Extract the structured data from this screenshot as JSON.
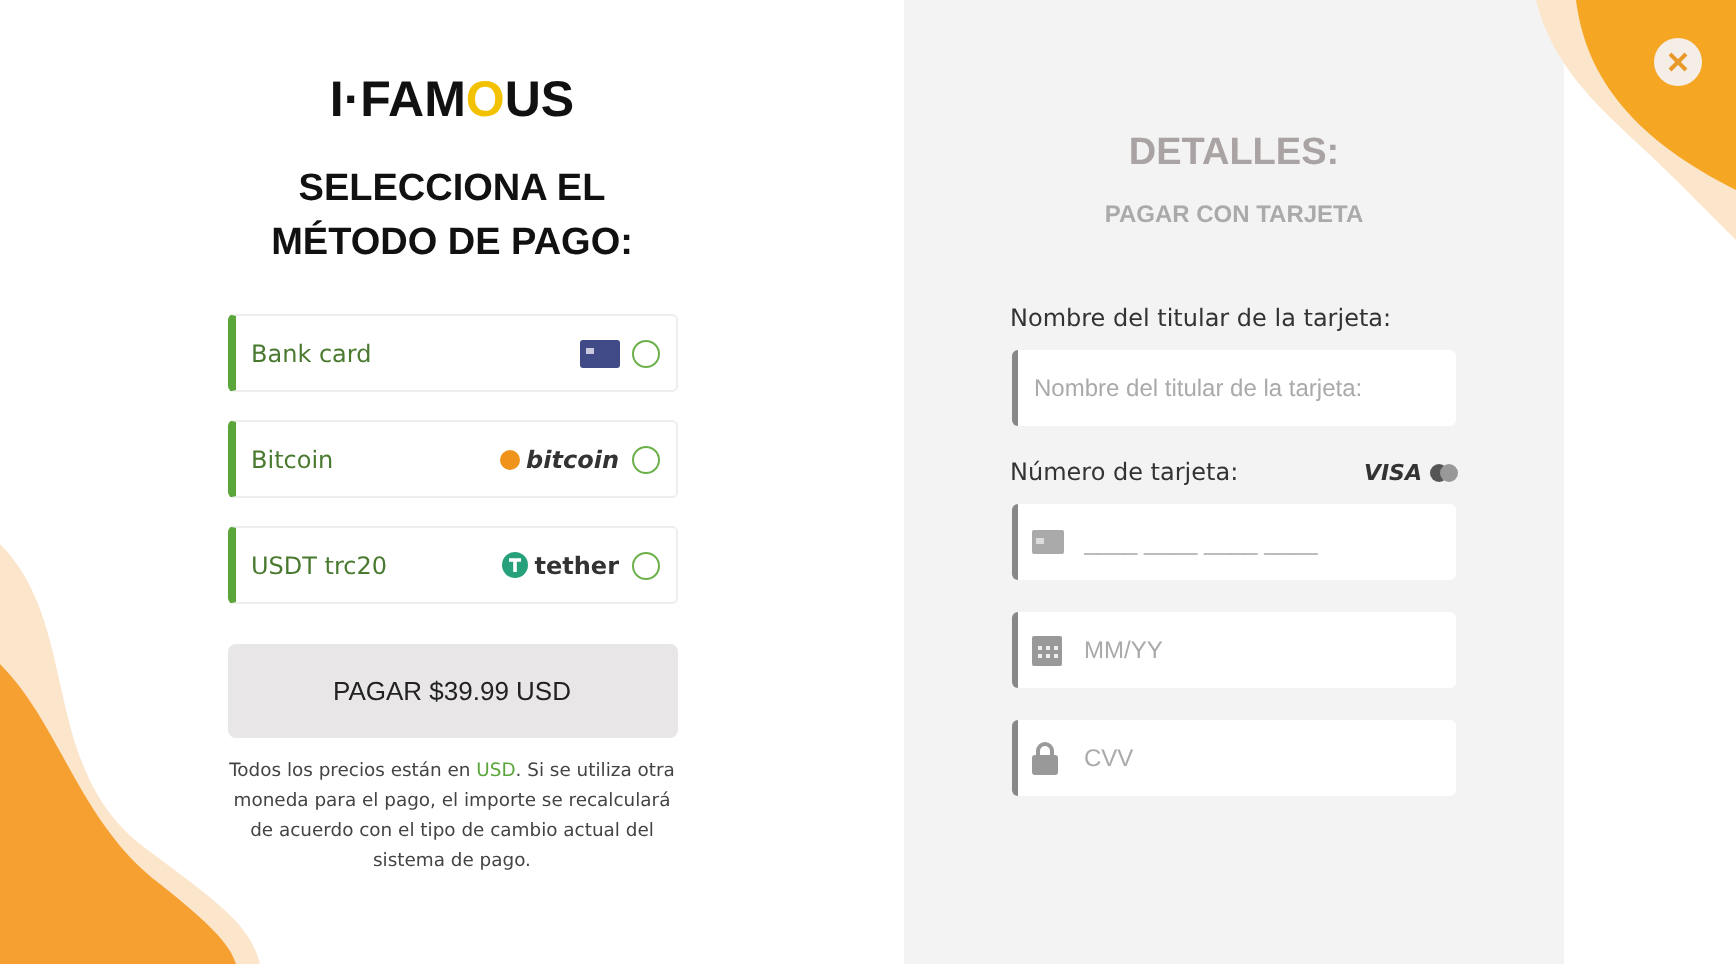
{
  "logo": [
    {
      "text": "I·FAM",
      "highlight": false
    },
    {
      "text": "O",
      "highlight": true
    },
    {
      "text": "US",
      "highlight": false
    }
  ],
  "heading": "SELECCIONA EL MÉTODO DE PAGO:",
  "methods": [
    {
      "label": "Bank card",
      "kind": "card",
      "selected": false
    },
    {
      "label": "Bitcoin",
      "kind": "bitcoin",
      "brand": "bitcoin",
      "selected": false
    },
    {
      "label": "USDT trc20",
      "kind": "tether",
      "brand": "tether",
      "selected": false
    }
  ],
  "pay_button": "PAGAR $39.99 USD",
  "note": {
    "before": "Todos los precios están en ",
    "highlight": "USD",
    "after": ". Si se utiliza otra moneda para el pago, el importe se recalculará de acuerdo con el tipo de cambio actual del sistema de pago."
  },
  "details": {
    "title": "DETALLES:",
    "subtitle": "PAGAR CON TARJETA",
    "name_label": "Nombre del titular de la tarjeta:",
    "number_label": "Número de tarjeta:",
    "visa": "VISA",
    "fields": [
      {
        "kind": "name",
        "placeholder": "Nombre del titular de la tarjeta:"
      },
      {
        "kind": "card",
        "placeholder": "____ ____ ____ ____"
      },
      {
        "kind": "date",
        "placeholder": "MM/YY"
      },
      {
        "kind": "cvv",
        "placeholder": "CVV"
      }
    ]
  }
}
